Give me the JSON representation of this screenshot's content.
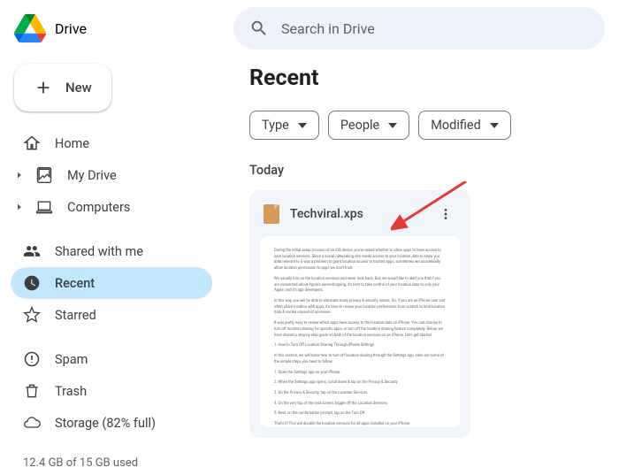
{
  "app_name": "Drive",
  "search": {
    "placeholder": "Search in Drive"
  },
  "new_button": "New",
  "page_title": "Recent",
  "nav": {
    "home": "Home",
    "my_drive": "My Drive",
    "computers": "Computers",
    "shared": "Shared with me",
    "recent": "Recent",
    "starred": "Starred",
    "spam": "Spam",
    "trash": "Trash",
    "storage": "Storage (82% full)"
  },
  "storage_percent": 82,
  "storage_text": "12.4 GB of 15 GB used",
  "chips": {
    "type": "Type",
    "people": "People",
    "modified": "Modified"
  },
  "section_label": "Today",
  "file": {
    "name": "Techviral.xps"
  }
}
